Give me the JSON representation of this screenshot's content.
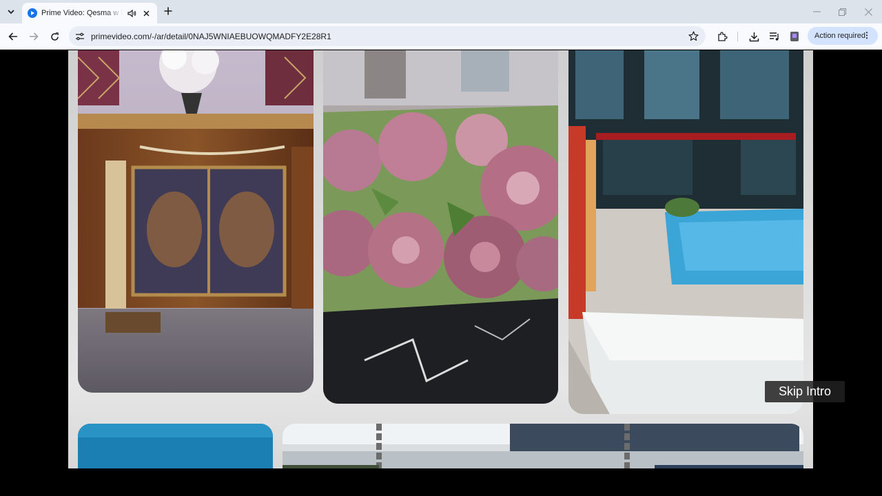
{
  "browser": {
    "tab": {
      "title": "Prime Video: Qesma w Nasee",
      "favicon": "prime-video-icon"
    },
    "new_tab_icon": "plus-icon",
    "window_controls": [
      "minimize-icon",
      "restore-icon",
      "close-icon"
    ]
  },
  "toolbar": {
    "url": "primevideo.com/-/ar/detail/0NAJ5WNIAEBUOWQMADFY2E28R1",
    "action_required_label": "Action required",
    "icons": [
      "back-icon",
      "forward-icon",
      "reload-icon",
      "site-info-icon",
      "bookmark-star-icon",
      "extensions-icon",
      "download-icon",
      "media-control-icon",
      "profile-icon",
      "more-menu-icon"
    ]
  },
  "player": {
    "skip_intro_label": "Skip Intro",
    "scene_tiles": [
      "ornate-cabinet",
      "pink-roses",
      "villa-pool",
      "blue-panel",
      "swing-chains"
    ]
  },
  "colors": {
    "accent": "#1a73e8",
    "action_chip": "#d3e3fd",
    "tabstrip": "#dde3ea",
    "toolbar": "#f8fafd"
  }
}
